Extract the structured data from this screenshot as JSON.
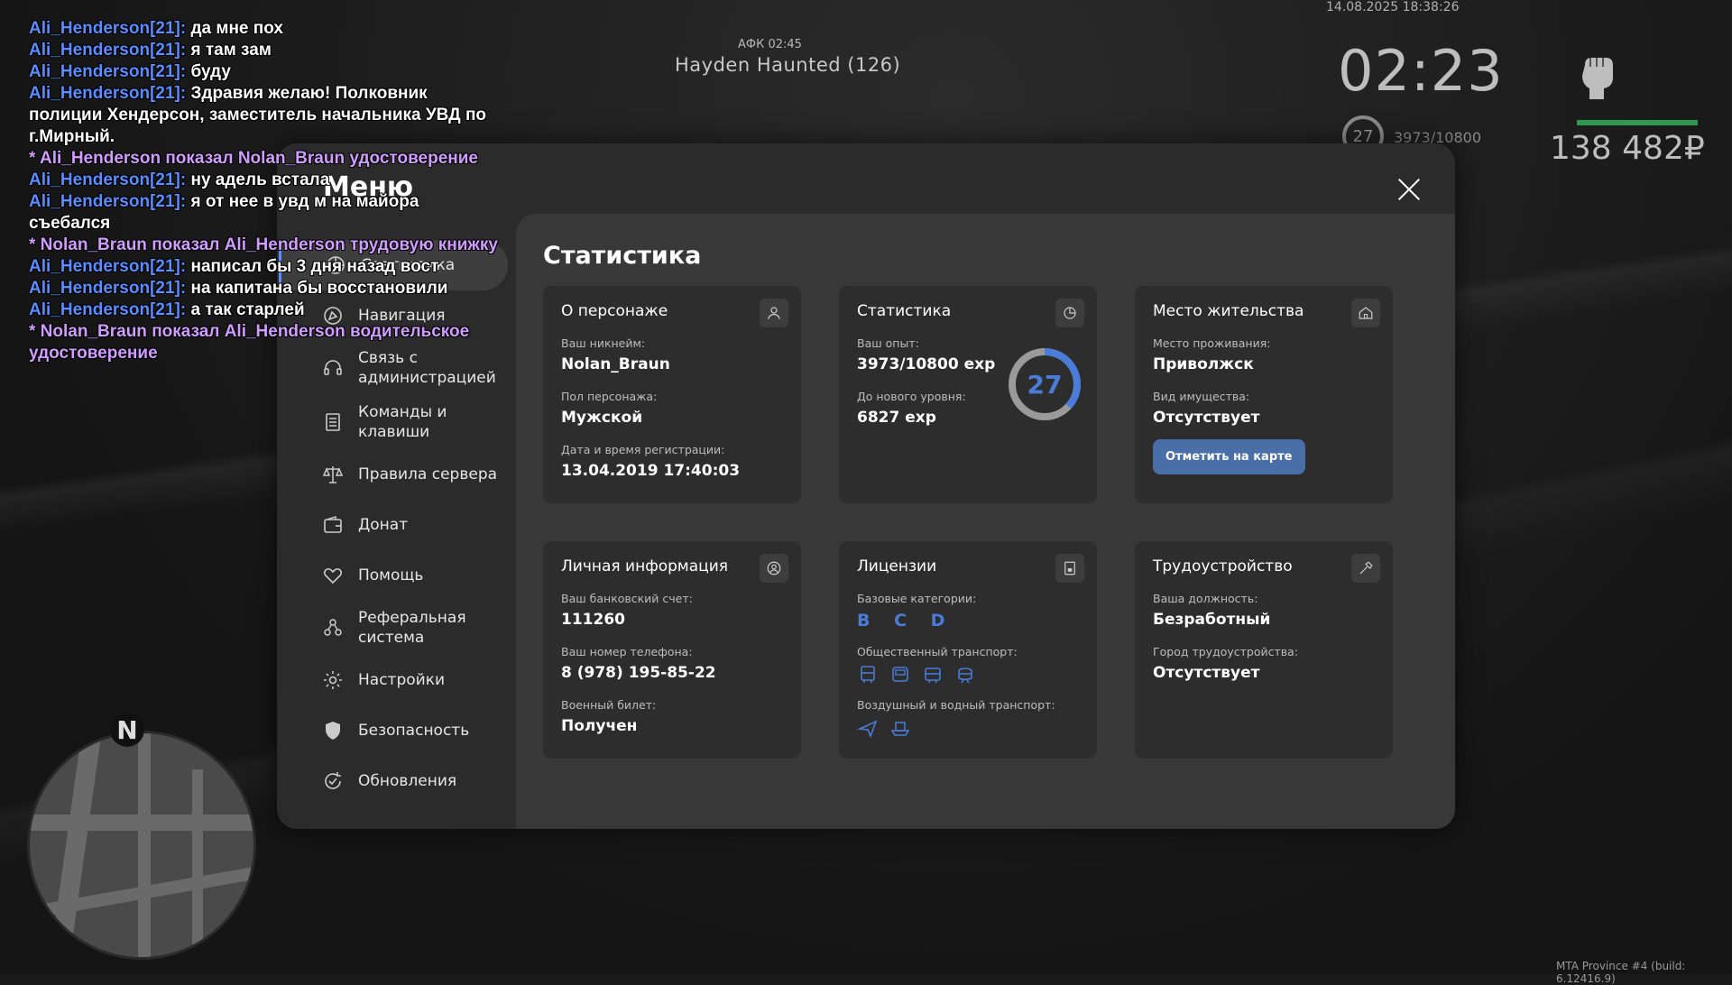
{
  "chat": [
    {
      "type": "msg",
      "nick": "Ali_Henderson[21]:",
      "text": " да мне пох"
    },
    {
      "type": "msg",
      "nick": "Ali_Henderson[21]:",
      "text": " я там зам"
    },
    {
      "type": "msg",
      "nick": "Ali_Henderson[21]:",
      "text": " буду"
    },
    {
      "type": "msg",
      "nick": "Ali_Henderson[21]:",
      "text": " Здравия желаю! Полковник полиции Хендерсон, заместитель начальника  УВД по г.Мирный."
    },
    {
      "type": "action",
      "text": "* Ali_Henderson показал Nolan_Braun удостоверение"
    },
    {
      "type": "msg",
      "nick": "Ali_Henderson[21]:",
      "text": " ну адель встала"
    },
    {
      "type": "msg",
      "nick": "Ali_Henderson[21]:",
      "text": " я от нее в увд м на майора  съебался"
    },
    {
      "type": "action",
      "text": "* Nolan_Braun показал Ali_Henderson трудовую книжку"
    },
    {
      "type": "msg",
      "nick": "Ali_Henderson[21]:",
      "text": " написал бы 3 дня назад вост"
    },
    {
      "type": "msg",
      "nick": "Ali_Henderson[21]:",
      "text": " на капитана бы восстановили"
    },
    {
      "type": "msg",
      "nick": "Ali_Henderson[21]:",
      "text": " а так старлей"
    },
    {
      "type": "action",
      "text": "* Nolan_Braun показал Ali_Henderson водительское удостоверение"
    }
  ],
  "hud": {
    "afk": "АФК 02:45",
    "target": "Hayden Haunted (126)",
    "datetime": "14.08.2025 18:38:26",
    "clock": "02:23",
    "level": "27",
    "exp": "3973/10800",
    "money": "138 482₽",
    "health_fraction": 1.0,
    "compass": "N",
    "build": "MTA Province #4 (build: 6.12416.9)"
  },
  "menu": {
    "title": "Меню",
    "items": [
      {
        "label": "Статистика",
        "icon": "chart-icon",
        "active": true
      },
      {
        "label": "Навигация",
        "icon": "navigation-icon"
      },
      {
        "label": "Связь с администрацией",
        "icon": "headset-icon"
      },
      {
        "label": "Команды и клавиши",
        "icon": "document-icon"
      },
      {
        "label": "Правила сервера",
        "icon": "scales-icon"
      },
      {
        "label": "Донат",
        "icon": "wallet-icon"
      },
      {
        "label": "Помощь",
        "icon": "handshake-icon"
      },
      {
        "label": "Реферальная система",
        "icon": "referral-icon"
      },
      {
        "label": "Настройки",
        "icon": "gear-icon"
      },
      {
        "label": "Безопасность",
        "icon": "shield-icon"
      },
      {
        "label": "Обновления",
        "icon": "refresh-icon"
      }
    ]
  },
  "section_title": "Статистика",
  "cards": {
    "character": {
      "title": "О персонаже",
      "nick_label": "Ваш никнейм:",
      "nick": "Nolan_Braun",
      "gender_label": "Пол персонажа:",
      "gender": "Мужской",
      "reg_label": "Дата и время регистрации:",
      "reg": "13.04.2019 17:40:03"
    },
    "stats": {
      "title": "Статистика",
      "exp_label": "Ваш опыт:",
      "exp": "3973/10800 exp",
      "next_label": "До нового уровня:",
      "next": "6827 exp",
      "level": "27",
      "progress": 0.368
    },
    "residence": {
      "title": "Место жительства",
      "place_label": "Место проживания:",
      "place": "Приволжск",
      "property_label": "Вид имущества:",
      "property": "Отсутствует",
      "button": "Отметить на карте"
    },
    "personal": {
      "title": "Личная информация",
      "bank_label": "Ваш банковский счет:",
      "bank": "111260",
      "phone_label": "Ваш номер телефона:",
      "phone": "8 (978) 195-85-22",
      "military_label": "Военный билет:",
      "military": "Получен"
    },
    "licenses": {
      "title": "Лицензии",
      "base_label": "Базовые категории:",
      "base": "B C D",
      "public_label": "Общественный транспорт:",
      "air_label": "Воздушный и водный транспорт:"
    },
    "job": {
      "title": "Трудоустройство",
      "position_label": "Ваша должность:",
      "position": "Безработный",
      "city_label": "Город трудоустройства:",
      "city": "Отсутствует"
    }
  },
  "colors": {
    "accent": "#4a7cd8",
    "button": "#4a6fa8",
    "nick": "#5a8dff",
    "action": "#d19cff",
    "health": "#2d9a4f"
  }
}
